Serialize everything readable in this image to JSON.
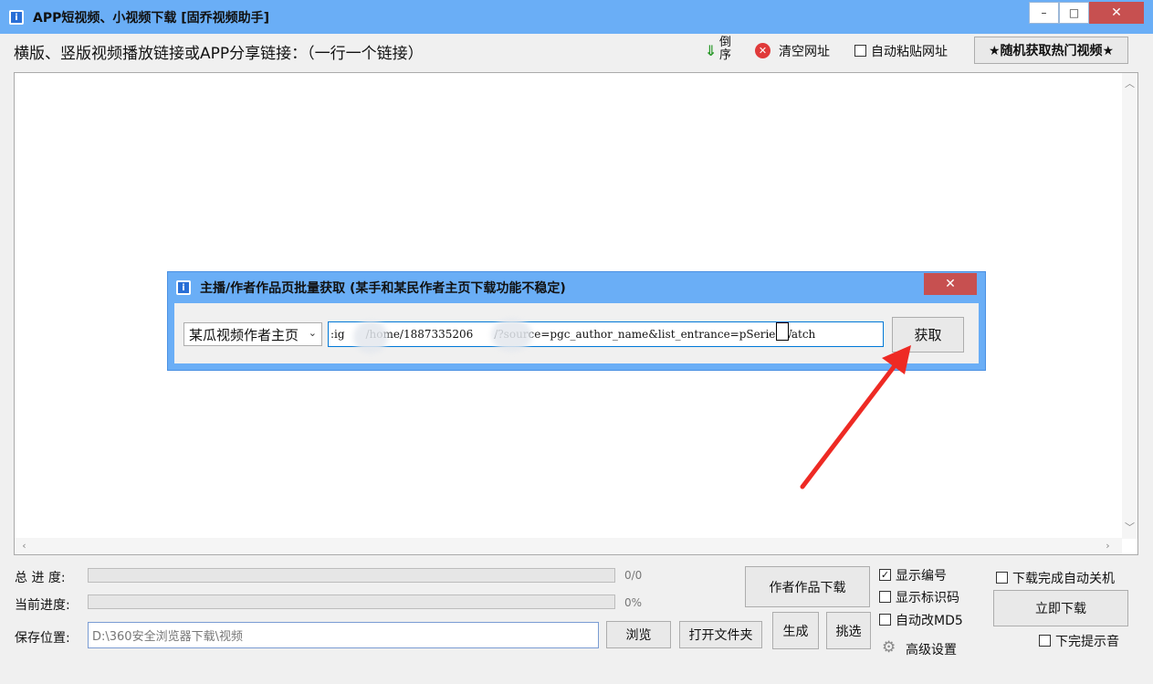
{
  "window": {
    "title": "APP短视频、小视频下载 [固乔视频助手]",
    "minimize_glyph": "–",
    "maximize_glyph": "□",
    "close_glyph": "✕"
  },
  "toolbar": {
    "prompt": "横版、竖版视频播放链接或APP分享链接：（一行一个链接）",
    "reverse_label": "倒序",
    "clear_label": "清空网址",
    "auto_paste_label": "自动粘贴网址",
    "random_hot_label": "★随机获取热门视频★"
  },
  "dialog": {
    "title": "主播/作者作品页批量获取 (某手和某民作者主页下载功能不稳定)",
    "close_glyph": "✕",
    "platform_selected": "某瓜视频作者主页",
    "url_value": ":ig      /home/1887335206      /?source=pgc_author_name&list_entrance=pSeriesWatch",
    "fetch_label": "获取"
  },
  "progress": {
    "total_label": "总 进 度:",
    "total_value": "0/0",
    "total_fraction": 0,
    "current_label": "当前进度:",
    "current_value": "0%",
    "current_fraction": 0
  },
  "save": {
    "label": "保存位置:",
    "path": "D:\\360安全浏览器下载\\视频"
  },
  "buttons": {
    "browse": "浏览",
    "open_folder": "打开文件夹",
    "author_download": "作者作品下载",
    "generate": "生成",
    "pick": "挑选",
    "download_now": "立即下载"
  },
  "options": {
    "show_number": {
      "label": "显示编号",
      "checked": true
    },
    "show_id_code": {
      "label": "显示标识码",
      "checked": false
    },
    "auto_md5": {
      "label": "自动改MD5",
      "checked": false
    },
    "advanced": "高级设置",
    "shutdown_after": {
      "label": "下载完成自动关机",
      "checked": false
    },
    "done_sound": {
      "label": "下完提示音",
      "checked": false
    }
  },
  "colors": {
    "titlebar": "#6aaef6",
    "dialog_border": "#4a90e2",
    "close_red": "#c75050",
    "arrow_red": "#ee2a24"
  }
}
